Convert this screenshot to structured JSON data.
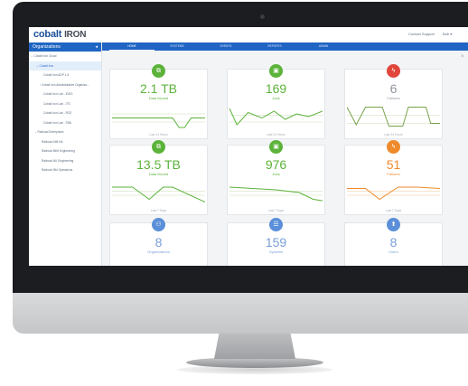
{
  "app": {
    "logo_main": "cobalt",
    "logo_sub": "IRON",
    "support": "Contact Support",
    "user": "Bob ▾"
  },
  "sidebar": {
    "title": "Organizations",
    "toggle": "◂",
    "items": [
      {
        "label": "⌄ Cobalt Iron Cloud",
        "indent": 2
      },
      {
        "label": "⌄ Cobalt Iron",
        "indent": 8,
        "selected": true
      },
      {
        "label": "Cobalt Iron ADP 1.5",
        "indent": 16
      },
      {
        "label": "› Cobalt Iron Administrative Organiza...",
        "indent": 12
      },
      {
        "label": "Cobalt Iron Lab - IDEG",
        "indent": 16
      },
      {
        "label": "Cobalt Iron Lab - ITS",
        "indent": 16
      },
      {
        "label": "Cobalt Iron Lab - RCE",
        "indent": 16
      },
      {
        "label": "Cobalt Iron Lab - TBB",
        "indent": 16
      },
      {
        "label": "⌄ Railroad Enterprises",
        "indent": 6
      },
      {
        "label": "Railroad AIM HA",
        "indent": 14
      },
      {
        "label": "Railroad MIM Engineering",
        "indent": 14
      },
      {
        "label": "Railroad NU Engineering",
        "indent": 14
      },
      {
        "label": "Railroad NM Operations",
        "indent": 14
      }
    ]
  },
  "nav": {
    "tabs": [
      "Home",
      "Systems",
      "Events",
      "Reports",
      "Admin"
    ]
  },
  "close": "×",
  "cards": [
    {
      "id": "data-24h",
      "icon": "⧉",
      "value": "2.1 TB",
      "label": "Data Moved",
      "footer": "Last 24 Hours",
      "color": "green"
    },
    {
      "id": "jobs-24h",
      "icon": "▣",
      "value": "169",
      "label": "Jobs",
      "footer": "Last 24 Hours",
      "color": "green"
    },
    {
      "id": "failures-24h",
      "icon": "ϟ",
      "value": "6",
      "label": "Failures",
      "footer": "Last 24 Hours",
      "color": "red"
    },
    {
      "id": "data-7d",
      "icon": "⧉",
      "value": "13.5 TB",
      "label": "Data Moved",
      "footer": "Last 7 Days",
      "color": "green"
    },
    {
      "id": "jobs-7d",
      "icon": "▣",
      "value": "976",
      "label": "Jobs",
      "footer": "Last 7 Days",
      "color": "green"
    },
    {
      "id": "failures-7d",
      "icon": "ϟ",
      "value": "51",
      "label": "Failures",
      "footer": "Last 7 Days",
      "color": "orange"
    },
    {
      "id": "organizations",
      "icon": "⚇",
      "value": "8",
      "label": "Organizations",
      "footer": "",
      "color": "blue"
    },
    {
      "id": "systems",
      "icon": "☰",
      "value": "159",
      "label": "Systems",
      "footer": "",
      "color": "blue"
    },
    {
      "id": "users",
      "icon": "⬆",
      "value": "8",
      "label": "Users",
      "footer": "",
      "color": "blue"
    }
  ],
  "colors": {
    "brand": "#1f66c4",
    "green": "#5cb33a",
    "red": "#e1463a",
    "orange": "#ee8a2c",
    "blue": "#5b8fd9"
  }
}
